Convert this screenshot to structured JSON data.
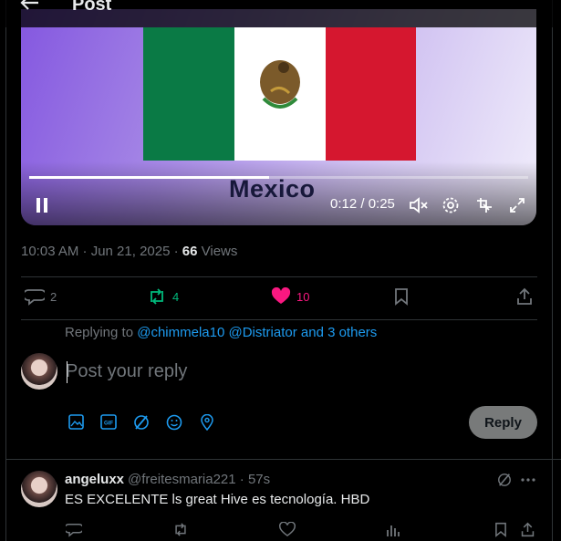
{
  "header": {
    "title": "Post",
    "back_icon": "arrow-left-icon"
  },
  "video": {
    "caption": "Mexico",
    "time": "0:12 / 0:25",
    "progress_fraction": 0.48,
    "controls": [
      "pause-icon",
      "mute-icon",
      "settings-icon",
      "pip-icon",
      "fullscreen-icon"
    ]
  },
  "post": {
    "timestamp": "10:03 AM · Jun 21, 2025 · ",
    "views_count": "66",
    "views_label": " Views",
    "replies": "2",
    "reposts": "4",
    "likes": "10"
  },
  "reply_box": {
    "replying_prefix": "Replying to ",
    "replying_to": "@chimmela10 @Distriator and 3 others",
    "placeholder": "Post your reply",
    "reply_label": "Reply"
  },
  "reply": {
    "name": "angeluxx",
    "handle": "@freitesmaria221 · 57s",
    "text": "ES EXCELENTE ls great Hive es tecnología. HBD"
  },
  "colors": {
    "accent": "#1d9bf0",
    "like": "#f91880",
    "repost": "#00ba7c",
    "muted": "#71767b"
  }
}
